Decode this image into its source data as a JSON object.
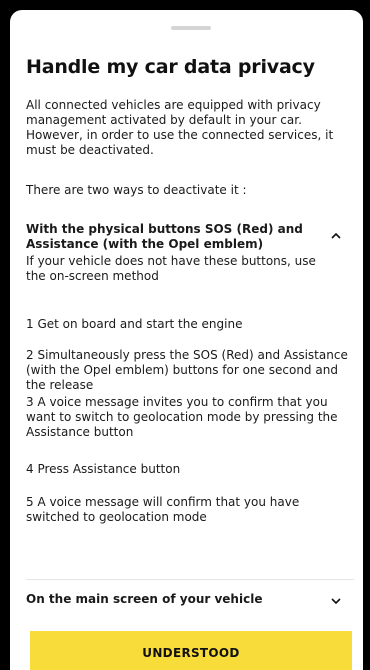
{
  "sheet": {
    "title": "Handle my car data privacy",
    "intro": "All connected vehicles are equipped with privacy management activated by default in your car. However, in order to use the connected services, it must be deactivated.",
    "two_ways": "There are two ways to deactivate it :"
  },
  "section_physical": {
    "heading": "With the physical buttons SOS (Red) and Assistance (with the Opel emblem)",
    "note": "If your vehicle does not have these buttons, use the on-screen method",
    "expanded": true,
    "toggle_icon": "chevron-up-icon",
    "steps": [
      "1 Get on board and start the engine",
      "2 Simultaneously press the SOS (Red) and Assistance (with the Opel emblem) buttons for one second and the release",
      "3 A voice message invites you to confirm that you want to switch to geolocation mode by pressing the Assistance button",
      "4 Press Assistance button",
      "5 A voice message will confirm that you have switched to geolocation mode"
    ]
  },
  "section_screen": {
    "heading": "On the main screen of your vehicle",
    "expanded": false,
    "toggle_icon": "chevron-down-icon"
  },
  "actions": {
    "understood_label": "UNDERSTOOD"
  },
  "colors": {
    "button": "#f7dc3a",
    "background": "#000000",
    "sheet": "#ffffff"
  }
}
